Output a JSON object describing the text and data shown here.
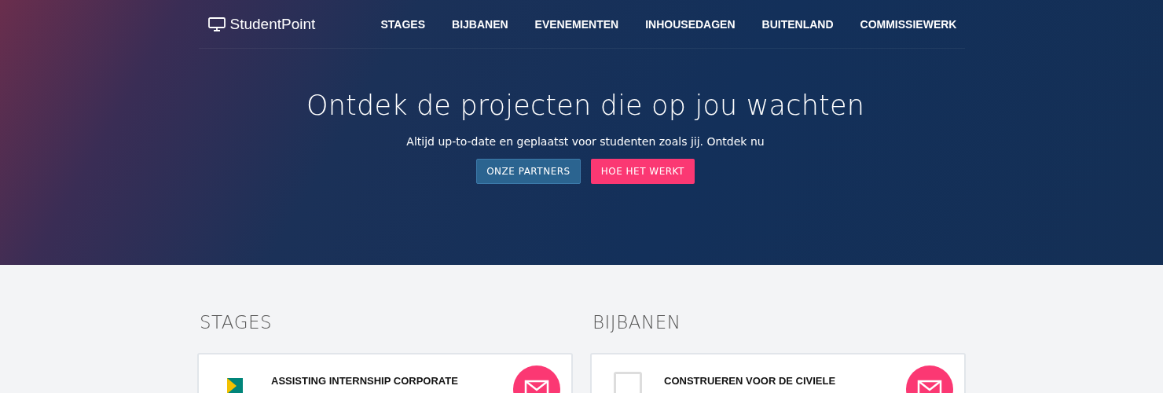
{
  "nav": {
    "brand": "StudentPoint",
    "links": [
      "STAGES",
      "BIJBANEN",
      "EVENEMENTEN",
      "INHOUSEDAGEN",
      "BUITENLAND",
      "COMMISSIEWERK"
    ]
  },
  "hero": {
    "title": "Ontdek de projecten die op jou wachten",
    "subtitle": "Altijd up-to-date en geplaatst voor studenten zoals jij. Ontdek nu",
    "buttons": [
      {
        "label": "ONZE PARTNERS",
        "kind": "secondary"
      },
      {
        "label": "HOE HET WERKT",
        "kind": "primary"
      }
    ]
  },
  "sections": [
    {
      "heading": "STAGES",
      "cards": [
        {
          "title": "ASSISTING INTERNSHIP CORPORATE",
          "kind": "company"
        }
      ]
    },
    {
      "heading": "BIJBANEN",
      "cards": [
        {
          "title": "CONSTRUEREN VOOR DE CIVIELE",
          "kind": "placeholder"
        }
      ]
    }
  ]
}
